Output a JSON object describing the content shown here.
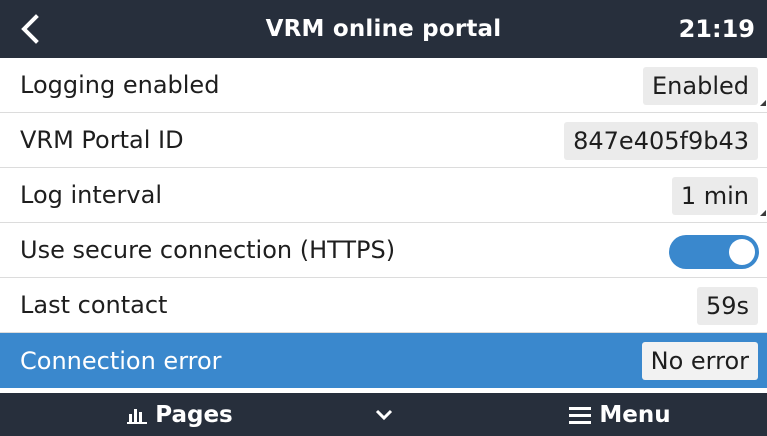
{
  "header": {
    "back_icon": "chevron-left-icon",
    "title": "VRM online portal",
    "time": "21:19"
  },
  "rows": [
    {
      "label": "Logging enabled",
      "value": "Enabled"
    },
    {
      "label": "VRM Portal ID",
      "value": "847e405f9b43"
    },
    {
      "label": "Log interval",
      "value": "1 min"
    },
    {
      "label": "Use secure connection (HTTPS)",
      "toggle_on": true
    },
    {
      "label": "Last contact",
      "value": "59s"
    },
    {
      "label": "Connection error",
      "value": "No error",
      "selected": true
    }
  ],
  "footer": {
    "pages_label": "Pages",
    "pages_icon": "bar-chart-icon",
    "down_icon": "chevron-down-icon",
    "menu_label": "Menu",
    "menu_icon": "hamburger-icon"
  },
  "colors": {
    "bar": "#272f3c",
    "accent": "#3a88cd",
    "value_bg": "#ebebeb"
  }
}
